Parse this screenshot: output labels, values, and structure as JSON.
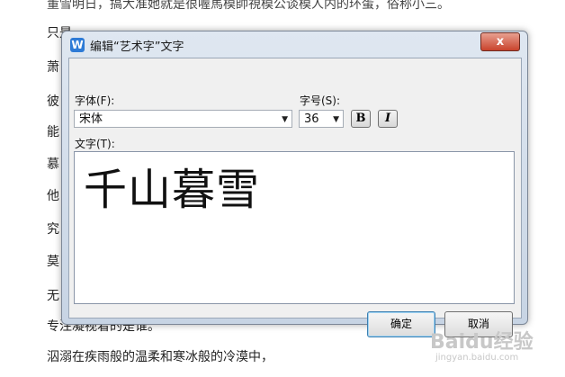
{
  "background": {
    "top_line": "董雪明日，搞大准她就是很喔馬模帥視模公谈模人内的环蛋，俗称小三。",
    "lines": [
      "只是",
      "萧",
      "彼",
      "能",
      "慕",
      "他",
      "究",
      "莫",
      "无",
      "专注凝视着的是谁。",
      "泅溺在疾雨般的温柔和寒冰般的冷漠中，"
    ]
  },
  "dialog": {
    "icon_letter": "W",
    "title": "编辑“艺术字”文字",
    "close_glyph": "x",
    "font_label": "字体(F):",
    "font_value": "宋体",
    "size_label": "字号(S):",
    "size_value": "36",
    "bold_label": "B",
    "italic_label": "I",
    "text_label": "文字(T):",
    "text_value": "千山暮雪",
    "ok_label": "确定",
    "cancel_label": "取消"
  },
  "watermark": {
    "brand": "Baidu经验",
    "url": "jingyan.baidu.com"
  }
}
